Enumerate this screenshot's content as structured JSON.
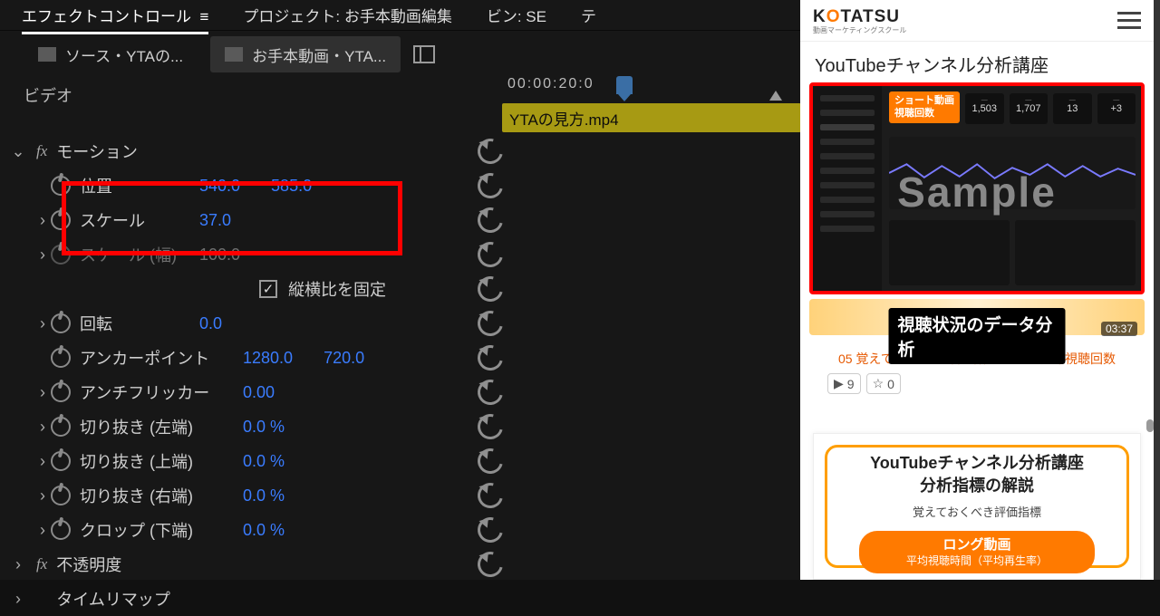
{
  "premiere": {
    "tabs": {
      "effect_controls": "エフェクトコントロール",
      "project": "プロジェクト: お手本動画編集",
      "bin": "ビン: SE",
      "extra": "テ"
    },
    "source_chip1": "ソース・YTAの...",
    "source_chip2": "お手本動画・YTA...",
    "video_header": "ビデオ",
    "timecode": "00:00:20:0",
    "clip_name": "YTAの見方.mp4",
    "motion": {
      "header": "モーション",
      "position_label": "位置",
      "position_x": "540.0",
      "position_y": "585.0",
      "scale_label": "スケール",
      "scale_value": "37.0",
      "scale_w_label": "スケール (幅)",
      "scale_w_value": "100.0",
      "lock_aspect": "縦横比を固定",
      "rotation_label": "回転",
      "rotation_value": "0.0",
      "anchor_label": "アンカーポイント",
      "anchor_x": "1280.0",
      "anchor_y": "720.0",
      "antiflicker_label": "アンチフリッカー",
      "antiflicker_value": "0.00",
      "crop_l_label": "切り抜き (左端)",
      "crop_l_value": "0.0 %",
      "crop_t_label": "切り抜き (上端)",
      "crop_t_value": "0.0 %",
      "crop_r_label": "切り抜き (右端)",
      "crop_r_value": "0.0 %",
      "crop_b_label": "クロップ (下端)",
      "crop_b_value": "0.0 %"
    },
    "opacity_label": "不透明度",
    "timeremap_label": "タイムリマップ"
  },
  "phone": {
    "brand_pre": "K",
    "brand_mid": "O",
    "brand_post": "TATSU",
    "brand_sub": "動画マーケティングスクール",
    "page_title": "YouTubeチャンネル分析講座",
    "video": {
      "badge_line1": "ショート動画",
      "badge_line2": "視聴回数",
      "stat1": "1,503",
      "stat2": "1,707",
      "stat3": "13",
      "stat4": "+3",
      "watermark": "Sample"
    },
    "banner": "視聴状況のデータ分析",
    "duration": "03:37",
    "caption": "05 覚えておくべき評価指標 ロング動画 視聴回数",
    "chip_play": "▶",
    "chip_play_n": "9",
    "chip_star": "☆",
    "chip_star_n": "0",
    "card2": {
      "title_l1": "YouTubeチャンネル分析講座",
      "title_l2": "分析指標の解説",
      "sub": "覚えておくべき評価指標",
      "btn_l1": "ロング動画",
      "btn_l2": "平均視聴時間（平均再生率）"
    }
  }
}
